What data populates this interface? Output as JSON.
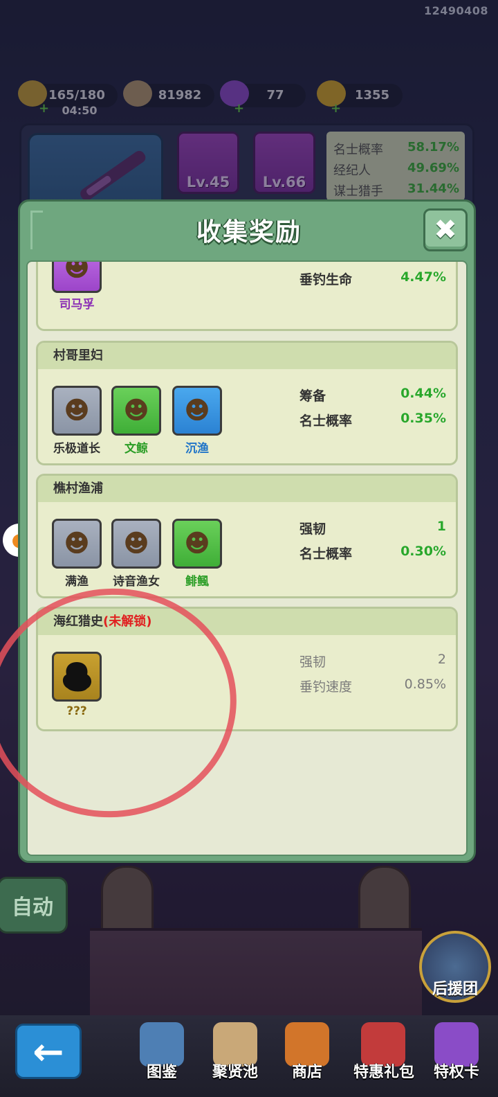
{
  "user_id": "12490408",
  "resources": [
    {
      "name": "stamina-icon",
      "value": "165/180",
      "timer": "04:50",
      "color": "#c9a03a"
    },
    {
      "name": "coin-icon",
      "value": "81982",
      "color": "#b69a74"
    },
    {
      "name": "gem-icon",
      "value": "77",
      "color": "#8e4ad0"
    },
    {
      "name": "ticket-icon",
      "value": "1355",
      "color": "#d8a82a"
    }
  ],
  "background_panel": {
    "tools": [
      {
        "name": "rope-icon",
        "level": "Lv.45"
      },
      {
        "name": "bait-icon",
        "level": "Lv.66"
      }
    ],
    "stats": [
      {
        "label": "名士概率",
        "value": "58.17%"
      },
      {
        "label": "经纪人",
        "value": "49.69%"
      },
      {
        "label": "谋士猎手",
        "value": "31.44%"
      }
    ]
  },
  "modal": {
    "title": "收集奖励",
    "groups": [
      {
        "title": "",
        "heroes": [
          {
            "name": "司马孚",
            "rarity": "purple"
          }
        ],
        "bonuses": [
          {
            "label": "垂钓生命",
            "value": "4.47%"
          }
        ]
      },
      {
        "title": "村哥里妇",
        "heroes": [
          {
            "name": "乐极道长",
            "rarity": "grey"
          },
          {
            "name": "文鲸",
            "rarity": "green"
          },
          {
            "name": "沉渔",
            "rarity": "blue"
          }
        ],
        "bonuses": [
          {
            "label": "筹备",
            "value": "0.44%"
          },
          {
            "label": "名士概率",
            "value": "0.35%"
          }
        ]
      },
      {
        "title": "樵村渔浦",
        "heroes": [
          {
            "name": "满渔",
            "rarity": "grey"
          },
          {
            "name": "诗音渔女",
            "rarity": "grey"
          },
          {
            "name": "鲱鲺",
            "rarity": "green"
          }
        ],
        "bonuses": [
          {
            "label": "强韧",
            "value": "1"
          },
          {
            "label": "名士概率",
            "value": "0.30%"
          }
        ]
      },
      {
        "title": "海红猎史",
        "locked_label": "(未解锁)",
        "heroes": [
          {
            "name": "???",
            "rarity": "gold"
          }
        ],
        "bonuses": [
          {
            "label": "强韧",
            "value": "2"
          },
          {
            "label": "垂钓速度",
            "value": "0.85%"
          }
        ]
      }
    ]
  },
  "side": {
    "auto_label": "自动",
    "rescue_label": "后援团"
  },
  "nav": [
    {
      "label": "图鉴",
      "icon": "book-icon",
      "color": "#4e7fb4"
    },
    {
      "label": "聚贤池",
      "icon": "map-icon",
      "color": "#c9a878"
    },
    {
      "label": "商店",
      "icon": "shop-icon",
      "color": "#d2752a"
    },
    {
      "label": "特惠礼包",
      "icon": "gift-icon",
      "color": "#c23b3b"
    },
    {
      "label": "特权卡",
      "icon": "card-icon",
      "color": "#8a4cc7"
    }
  ]
}
